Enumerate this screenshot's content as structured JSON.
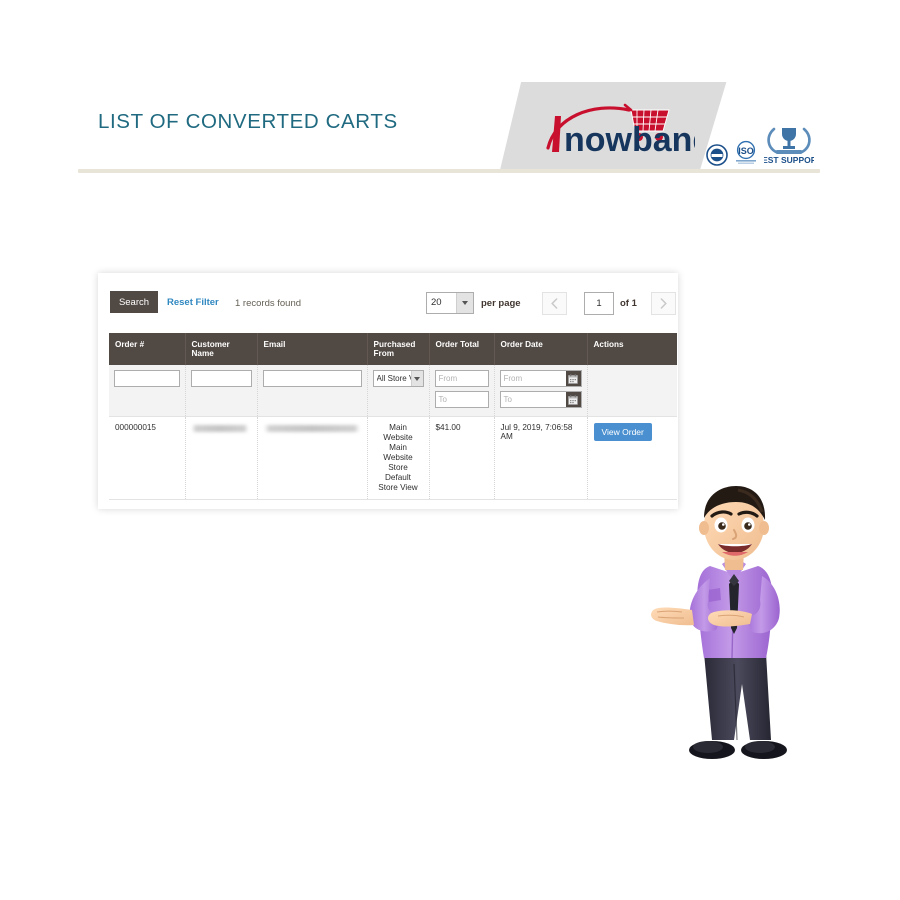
{
  "banner": {
    "title": "LIST OF CONVERTED CARTS",
    "logo_text": "nowband",
    "badges": [
      "certification-badge",
      "iso-badge",
      "best-support-badge"
    ],
    "best_support_label": "BEST SUPPORT",
    "iso_label": "ISO",
    "accent_color": "#1f6a80",
    "rule_color": "#e9e4d8"
  },
  "toolbar": {
    "search_label": "Search",
    "reset_filter_label": "Reset Filter",
    "records_found": "1 records found",
    "per_page_value": "20",
    "per_page_label": "per page",
    "pager_prev_icon": "chevron-left-icon",
    "pager_next_icon": "chevron-right-icon",
    "page_number": "1",
    "page_of": "of 1"
  },
  "grid": {
    "columns": [
      "Order #",
      "Customer Name",
      "Email",
      "Purchased From",
      "Order Total",
      "Order Date",
      "Actions"
    ],
    "filters": {
      "order_number": "",
      "customer_name": "",
      "email": "",
      "purchased_from": "All Store Vi",
      "order_total_from": "From",
      "order_total_to": "To",
      "order_date_from": "From",
      "order_date_to": "To",
      "calendar_icon": "calendar-icon"
    },
    "rows": [
      {
        "order_number": "000000015",
        "customer_name": "",
        "email": "",
        "purchased_from": "Main Website\nMain\nWebsite Store\nDefault\nStore View",
        "order_total": "$41.00",
        "order_date": "Jul 9, 2019, 7:06:58 AM",
        "action_label": "View Order"
      }
    ]
  },
  "colors": {
    "header_row": "#514943",
    "link": "#3088c0",
    "button_primary": "#4a90d0",
    "filter_row_bg": "#f3f3f3"
  }
}
